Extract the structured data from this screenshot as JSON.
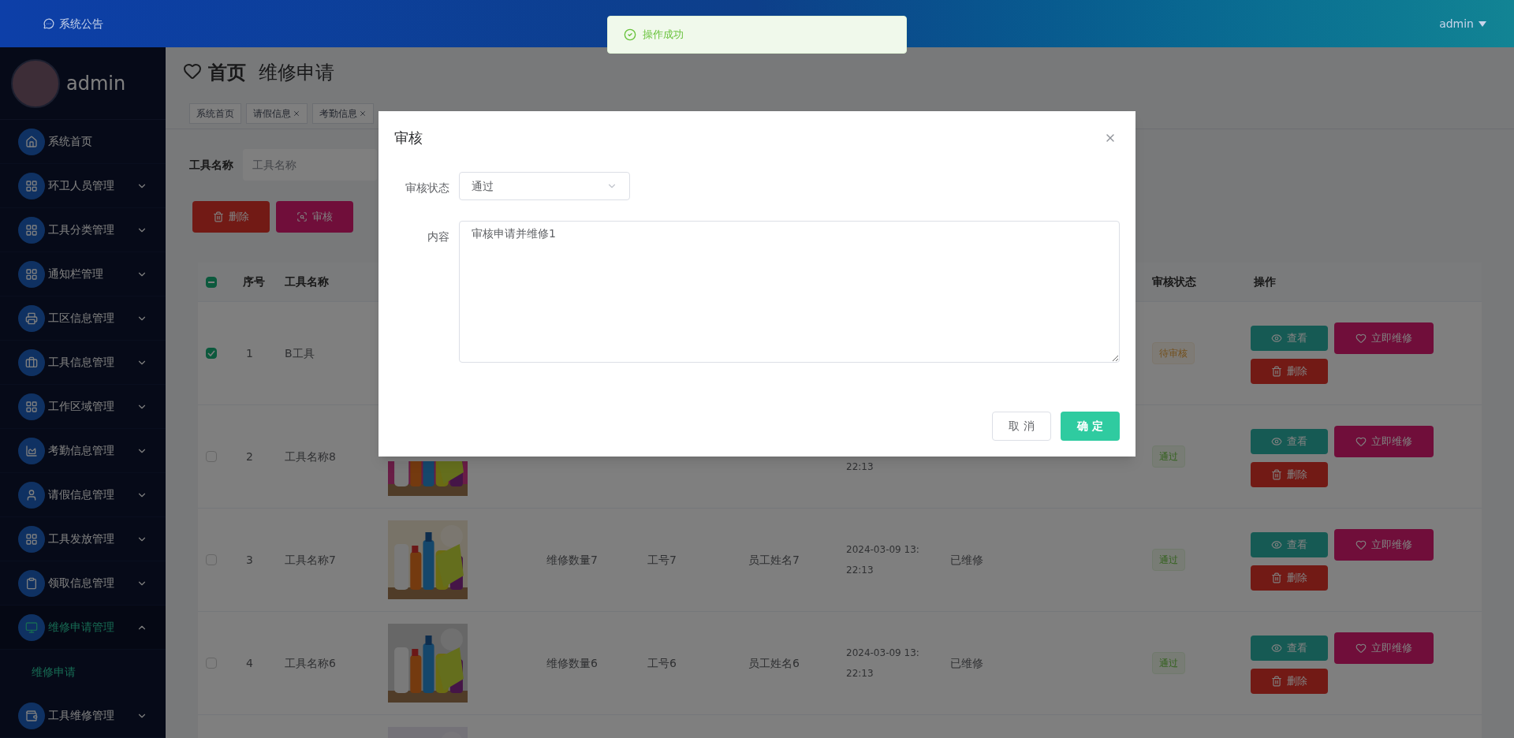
{
  "top_bar": {
    "announcement": "系统公告",
    "user": "admin"
  },
  "toast": {
    "message": "操作成功"
  },
  "sidebar": {
    "user": "admin",
    "items": [
      {
        "label": "系统首页",
        "kind": "link",
        "selected": false
      },
      {
        "label": "环卫人员管理",
        "kind": "menu",
        "selected": false,
        "expanded": false
      },
      {
        "label": "工具分类管理",
        "kind": "menu",
        "selected": false,
        "expanded": false
      },
      {
        "label": "通知栏管理",
        "kind": "menu",
        "selected": false,
        "expanded": false
      },
      {
        "label": "工区信息管理",
        "kind": "menu",
        "selected": false,
        "expanded": false
      },
      {
        "label": "工具信息管理",
        "kind": "menu",
        "selected": false,
        "expanded": false
      },
      {
        "label": "工作区域管理",
        "kind": "menu",
        "selected": false,
        "expanded": false
      },
      {
        "label": "考勤信息管理",
        "kind": "menu",
        "selected": false,
        "expanded": false
      },
      {
        "label": "请假信息管理",
        "kind": "menu",
        "selected": false,
        "expanded": false
      },
      {
        "label": "工具发放管理",
        "kind": "menu",
        "selected": false,
        "expanded": false
      },
      {
        "label": "领取信息管理",
        "kind": "menu",
        "selected": false,
        "expanded": false
      },
      {
        "label": "维修申请管理",
        "kind": "menu",
        "selected": true,
        "expanded": true,
        "children": [
          {
            "label": "维修申请",
            "selected": true
          }
        ]
      },
      {
        "label": "工具维修管理",
        "kind": "menu",
        "selected": false,
        "expanded": false
      }
    ]
  },
  "breadcrumb": [
    "首页",
    "维修申请"
  ],
  "tags": [
    {
      "label": "系统首页",
      "closable": false
    },
    {
      "label": "请假信息",
      "closable": true
    },
    {
      "label": "考勤信息",
      "closable": true
    }
  ],
  "search": {
    "label": "工具名称",
    "placeholder": "工具名称"
  },
  "actions": [
    {
      "kind": "delete",
      "label": "删除"
    },
    {
      "kind": "review",
      "label": "审核"
    }
  ],
  "table": {
    "header": {
      "indeterminate": true,
      "index": "序号",
      "name": "工具名称",
      "review": "审核状态",
      "operations": "操作"
    },
    "rows": [
      {
        "selected": true,
        "index": "1",
        "name": "B工具",
        "review": {
          "label": "待审核",
          "kind": "pending"
        },
        "actions": [
          {
            "kind": "view",
            "label": "查看"
          },
          {
            "kind": "repair",
            "label": "立即维修"
          },
          {
            "kind": "delete",
            "label": "删除"
          }
        ]
      },
      {
        "selected": false,
        "index": "2",
        "name": "工具名称8",
        "image": {
          "kind": "picture"
        },
        "time": "22:13",
        "review": {
          "label": "通过",
          "kind": "passed"
        },
        "actions": [
          {
            "kind": "view",
            "label": "查看"
          },
          {
            "kind": "repair",
            "label": "立即维修"
          },
          {
            "kind": "delete",
            "label": "删除"
          }
        ]
      },
      {
        "selected": false,
        "index": "3",
        "name": "工具名称7",
        "image": {
          "kind": "picture"
        },
        "quantity": "维修数量7",
        "staff_no": "工号7",
        "staff_name": "员工姓名7",
        "date": "2024-03-09 13:",
        "time": "22:13",
        "repair_status": "已维修",
        "review": {
          "label": "通过",
          "kind": "passed"
        },
        "actions": [
          {
            "kind": "view",
            "label": "查看"
          },
          {
            "kind": "repair",
            "label": "立即维修"
          },
          {
            "kind": "delete",
            "label": "删除"
          }
        ]
      },
      {
        "selected": false,
        "index": "4",
        "name": "工具名称6",
        "image": {
          "kind": "picture"
        },
        "quantity": "维修数量6",
        "staff_no": "工号6",
        "staff_name": "员工姓名6",
        "date": "2024-03-09 13:",
        "time": "22:13",
        "repair_status": "已维修",
        "review": {
          "label": "通过",
          "kind": "passed"
        },
        "actions": [
          {
            "kind": "view",
            "label": "查看"
          },
          {
            "kind": "repair",
            "label": "立即维修"
          },
          {
            "kind": "delete",
            "label": "删除"
          }
        ]
      },
      {
        "image": {
          "kind": "picture"
        }
      }
    ]
  },
  "modal": {
    "title": "审核",
    "fields": [
      {
        "kind": "select",
        "label": "审核状态",
        "value": "通过"
      },
      {
        "kind": "textarea",
        "label": "内容",
        "value": "审核申请并维修1"
      }
    ],
    "buttons": [
      {
        "kind": "cancel",
        "label": "取 消"
      },
      {
        "kind": "confirm",
        "label": "确 定"
      }
    ]
  }
}
